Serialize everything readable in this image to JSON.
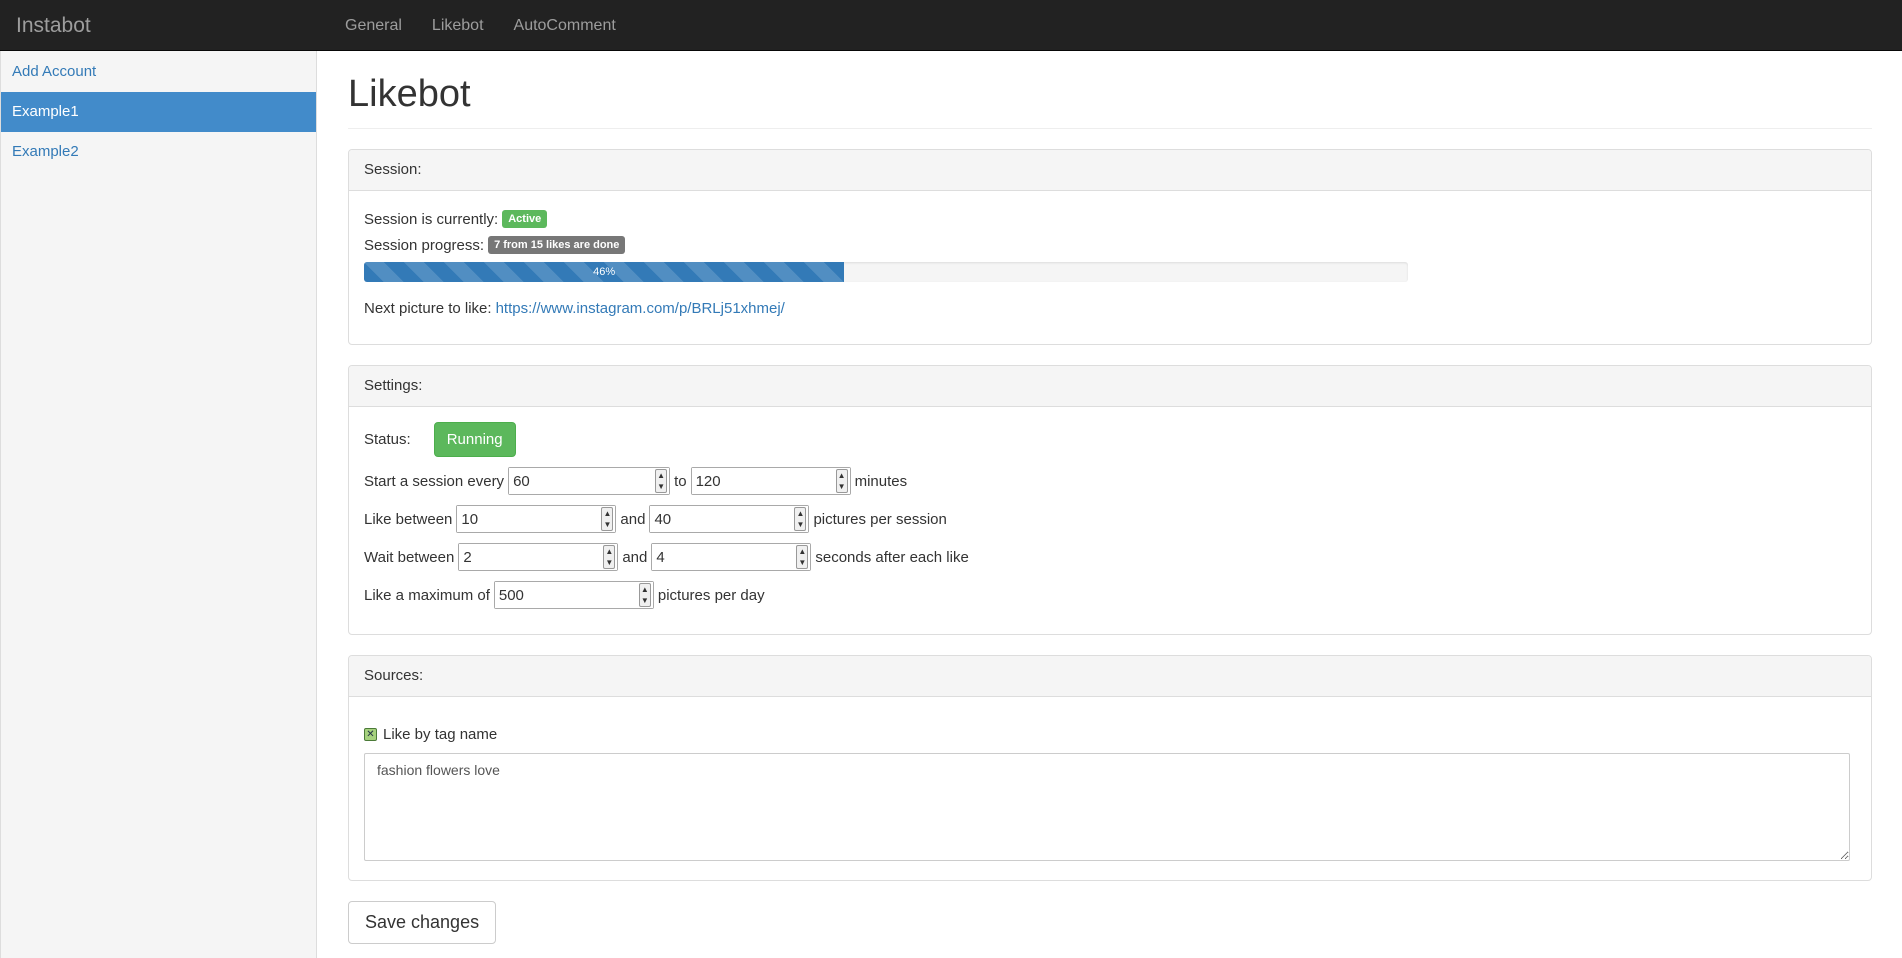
{
  "navbar": {
    "brand": "Instabot",
    "links": [
      "General",
      "Likebot",
      "AutoComment"
    ]
  },
  "sidebar": {
    "items": [
      {
        "label": "Add Account",
        "active": false
      },
      {
        "label": "Example1",
        "active": true
      },
      {
        "label": "Example2",
        "active": false
      }
    ]
  },
  "page": {
    "title": "Likebot"
  },
  "session": {
    "heading": "Session:",
    "status_label": "Session is currently:",
    "status_badge": "Active",
    "progress_label": "Session progress:",
    "progress_badge": "7 from 15 likes are done",
    "progress_text": "46%",
    "progress_fraction": 0.46,
    "next_label": "Next picture to like:",
    "next_link": "https://www.instagram.com/p/BRLj51xhmej/"
  },
  "settings": {
    "heading": "Settings:",
    "status_label": "Status:",
    "status_button": "Running",
    "session_every": {
      "prefix": "Start a session every",
      "min": "60",
      "mid": "to",
      "max": "120",
      "suffix": "minutes"
    },
    "like_between": {
      "prefix": "Like between",
      "min": "10",
      "mid": "and",
      "max": "40",
      "suffix": "pictures per session"
    },
    "wait_between": {
      "prefix": "Wait between",
      "min": "2",
      "mid": "and",
      "max": "4",
      "suffix": "seconds after each like"
    },
    "max_per_day": {
      "prefix": "Like a maximum of",
      "value": "500",
      "suffix": "pictures per day"
    }
  },
  "sources": {
    "heading": "Sources:",
    "tag_checkbox_label": "Like by tag name",
    "tag_checked": true,
    "tags_value": "fashion flowers love"
  },
  "actions": {
    "save_label": "Save changes"
  },
  "colors": {
    "navbar": "#222222",
    "active": "#428bca",
    "success": "#5cb85c",
    "link": "#337ab7"
  }
}
